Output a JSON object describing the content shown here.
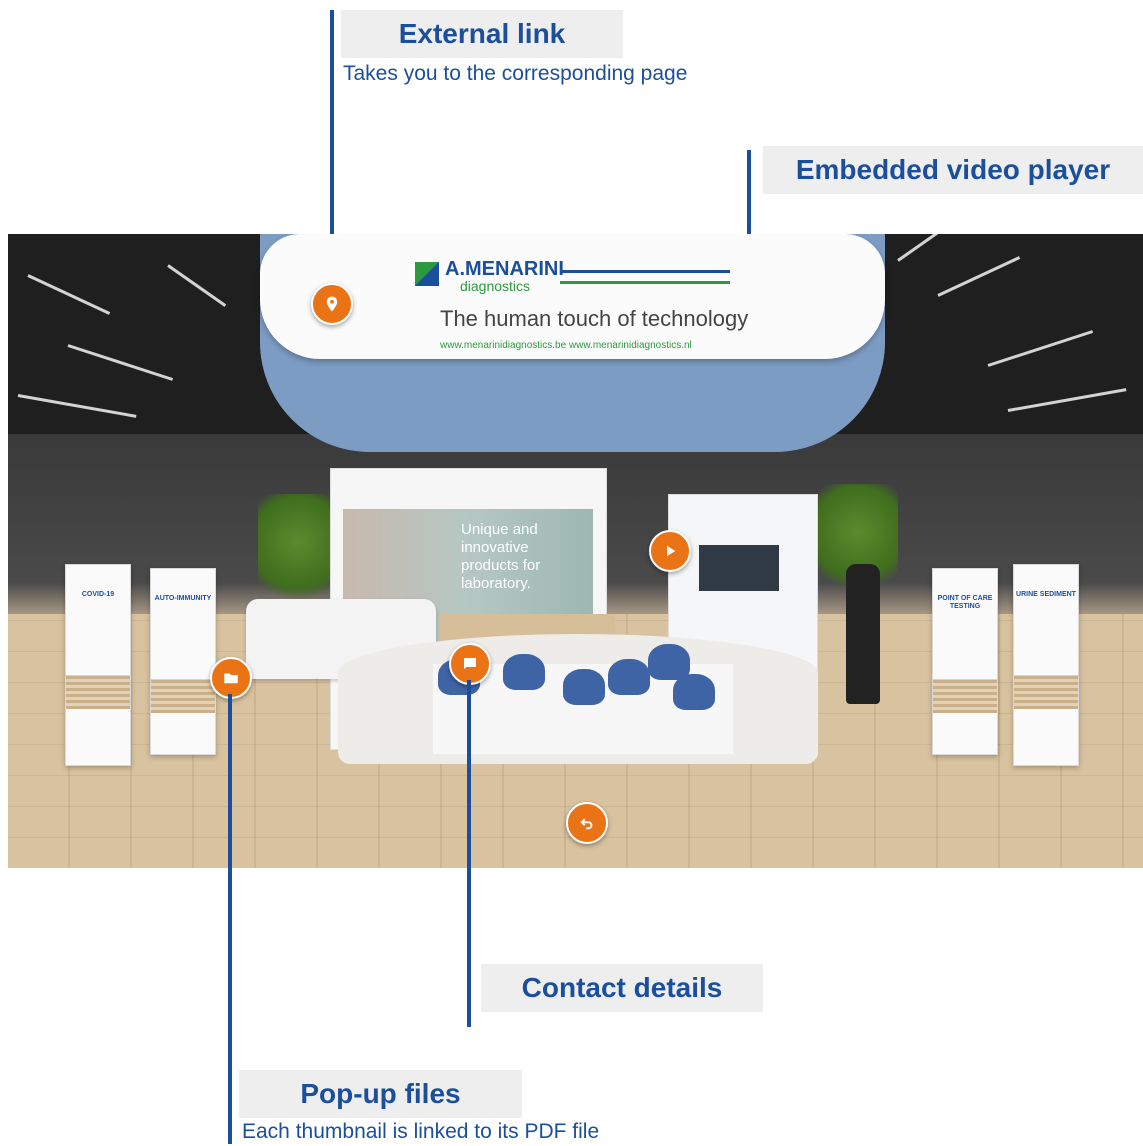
{
  "annotations": {
    "external_link": {
      "title": "External link",
      "description": "Takes you to the corresponding page"
    },
    "video_player": {
      "title": "Embedded video player"
    },
    "contact": {
      "title": "Contact details"
    },
    "popup_files": {
      "title": "Pop-up files",
      "description": "Each thumbnail is linked to its PDF file"
    }
  },
  "scene": {
    "banner": {
      "brand": "A.MENARINI",
      "brand_sub": "diagnostics",
      "tagline": "The human touch of technology",
      "urls": "www.menarinidiagnostics.be   www.menarinidiagnostics.nl"
    },
    "backwall_text": "Unique and innovative products for laboratory.",
    "panels": [
      "COVID-19",
      "AUTO-IMMUNITY",
      "POINT OF CARE TESTING",
      "URINE SEDIMENT"
    ]
  },
  "hotspots": [
    "location-pin-icon",
    "play-icon",
    "chat-icon",
    "folder-icon",
    "back-arrow-icon"
  ],
  "colors": {
    "accent": "#ea7316",
    "brand_blue": "#1b4f9c",
    "brand_green": "#2b9a3f",
    "label_bg": "#eeeeee"
  }
}
